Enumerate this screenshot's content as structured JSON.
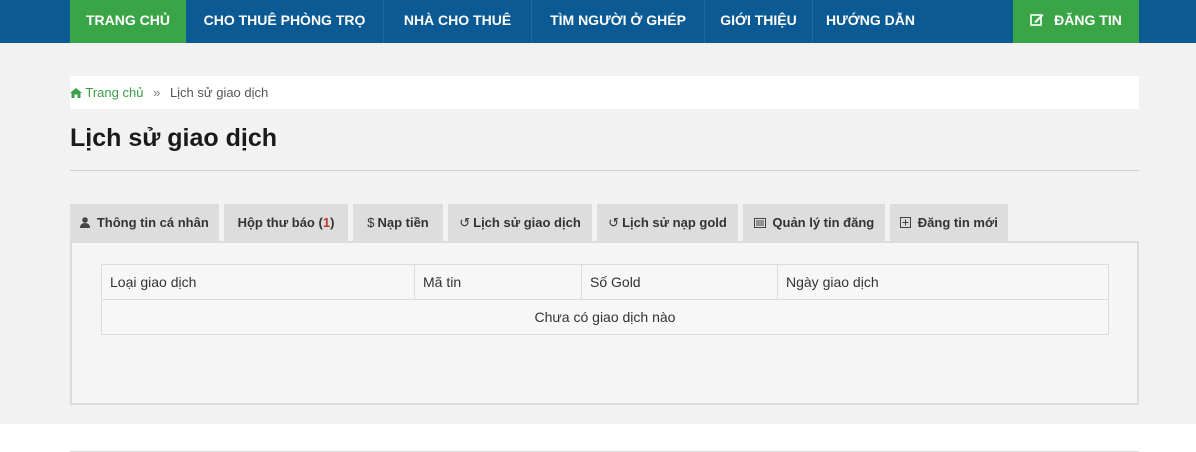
{
  "nav": {
    "home": "TRANG CHỦ",
    "rooms": "CHO THUÊ PHÒNG TRỌ",
    "houses": "NHÀ CHO THUÊ",
    "roommate": "TÌM NGƯỜI Ở GHÉP",
    "about": "GIỚI THIỆU",
    "guide": "HƯỚNG DẪN",
    "post": "ĐĂNG TIN"
  },
  "breadcrumb": {
    "home": "Trang chủ",
    "separator": "»",
    "current": "Lịch sử giao dịch"
  },
  "page": {
    "title": "Lịch sử giao dịch"
  },
  "tabs": [
    {
      "label": "Thông tin cá nhân",
      "icon": "user-icon"
    },
    {
      "label": "Hộp thư báo",
      "count_open": "(",
      "count": "1",
      "count_close": ")"
    },
    {
      "label": "Nạp tiền",
      "icon": "dollar-icon"
    },
    {
      "label": "Lịch sử giao dịch",
      "icon": "history-icon"
    },
    {
      "label": "Lịch sử nạp gold",
      "icon": "history-icon"
    },
    {
      "label": "Quản lý tin đăng",
      "icon": "list-icon"
    },
    {
      "label": "Đăng tin mới",
      "icon": "plus-square-icon"
    }
  ],
  "table": {
    "columns": [
      "Loại giao dịch",
      "Mã tin",
      "Số Gold",
      "Ngày giao dịch"
    ],
    "empty_message": "Chưa có giao dịch nào"
  },
  "colors": {
    "nav_background": "#0b5a93",
    "accent_green": "#3aa547",
    "tab_background": "#dddddd"
  }
}
